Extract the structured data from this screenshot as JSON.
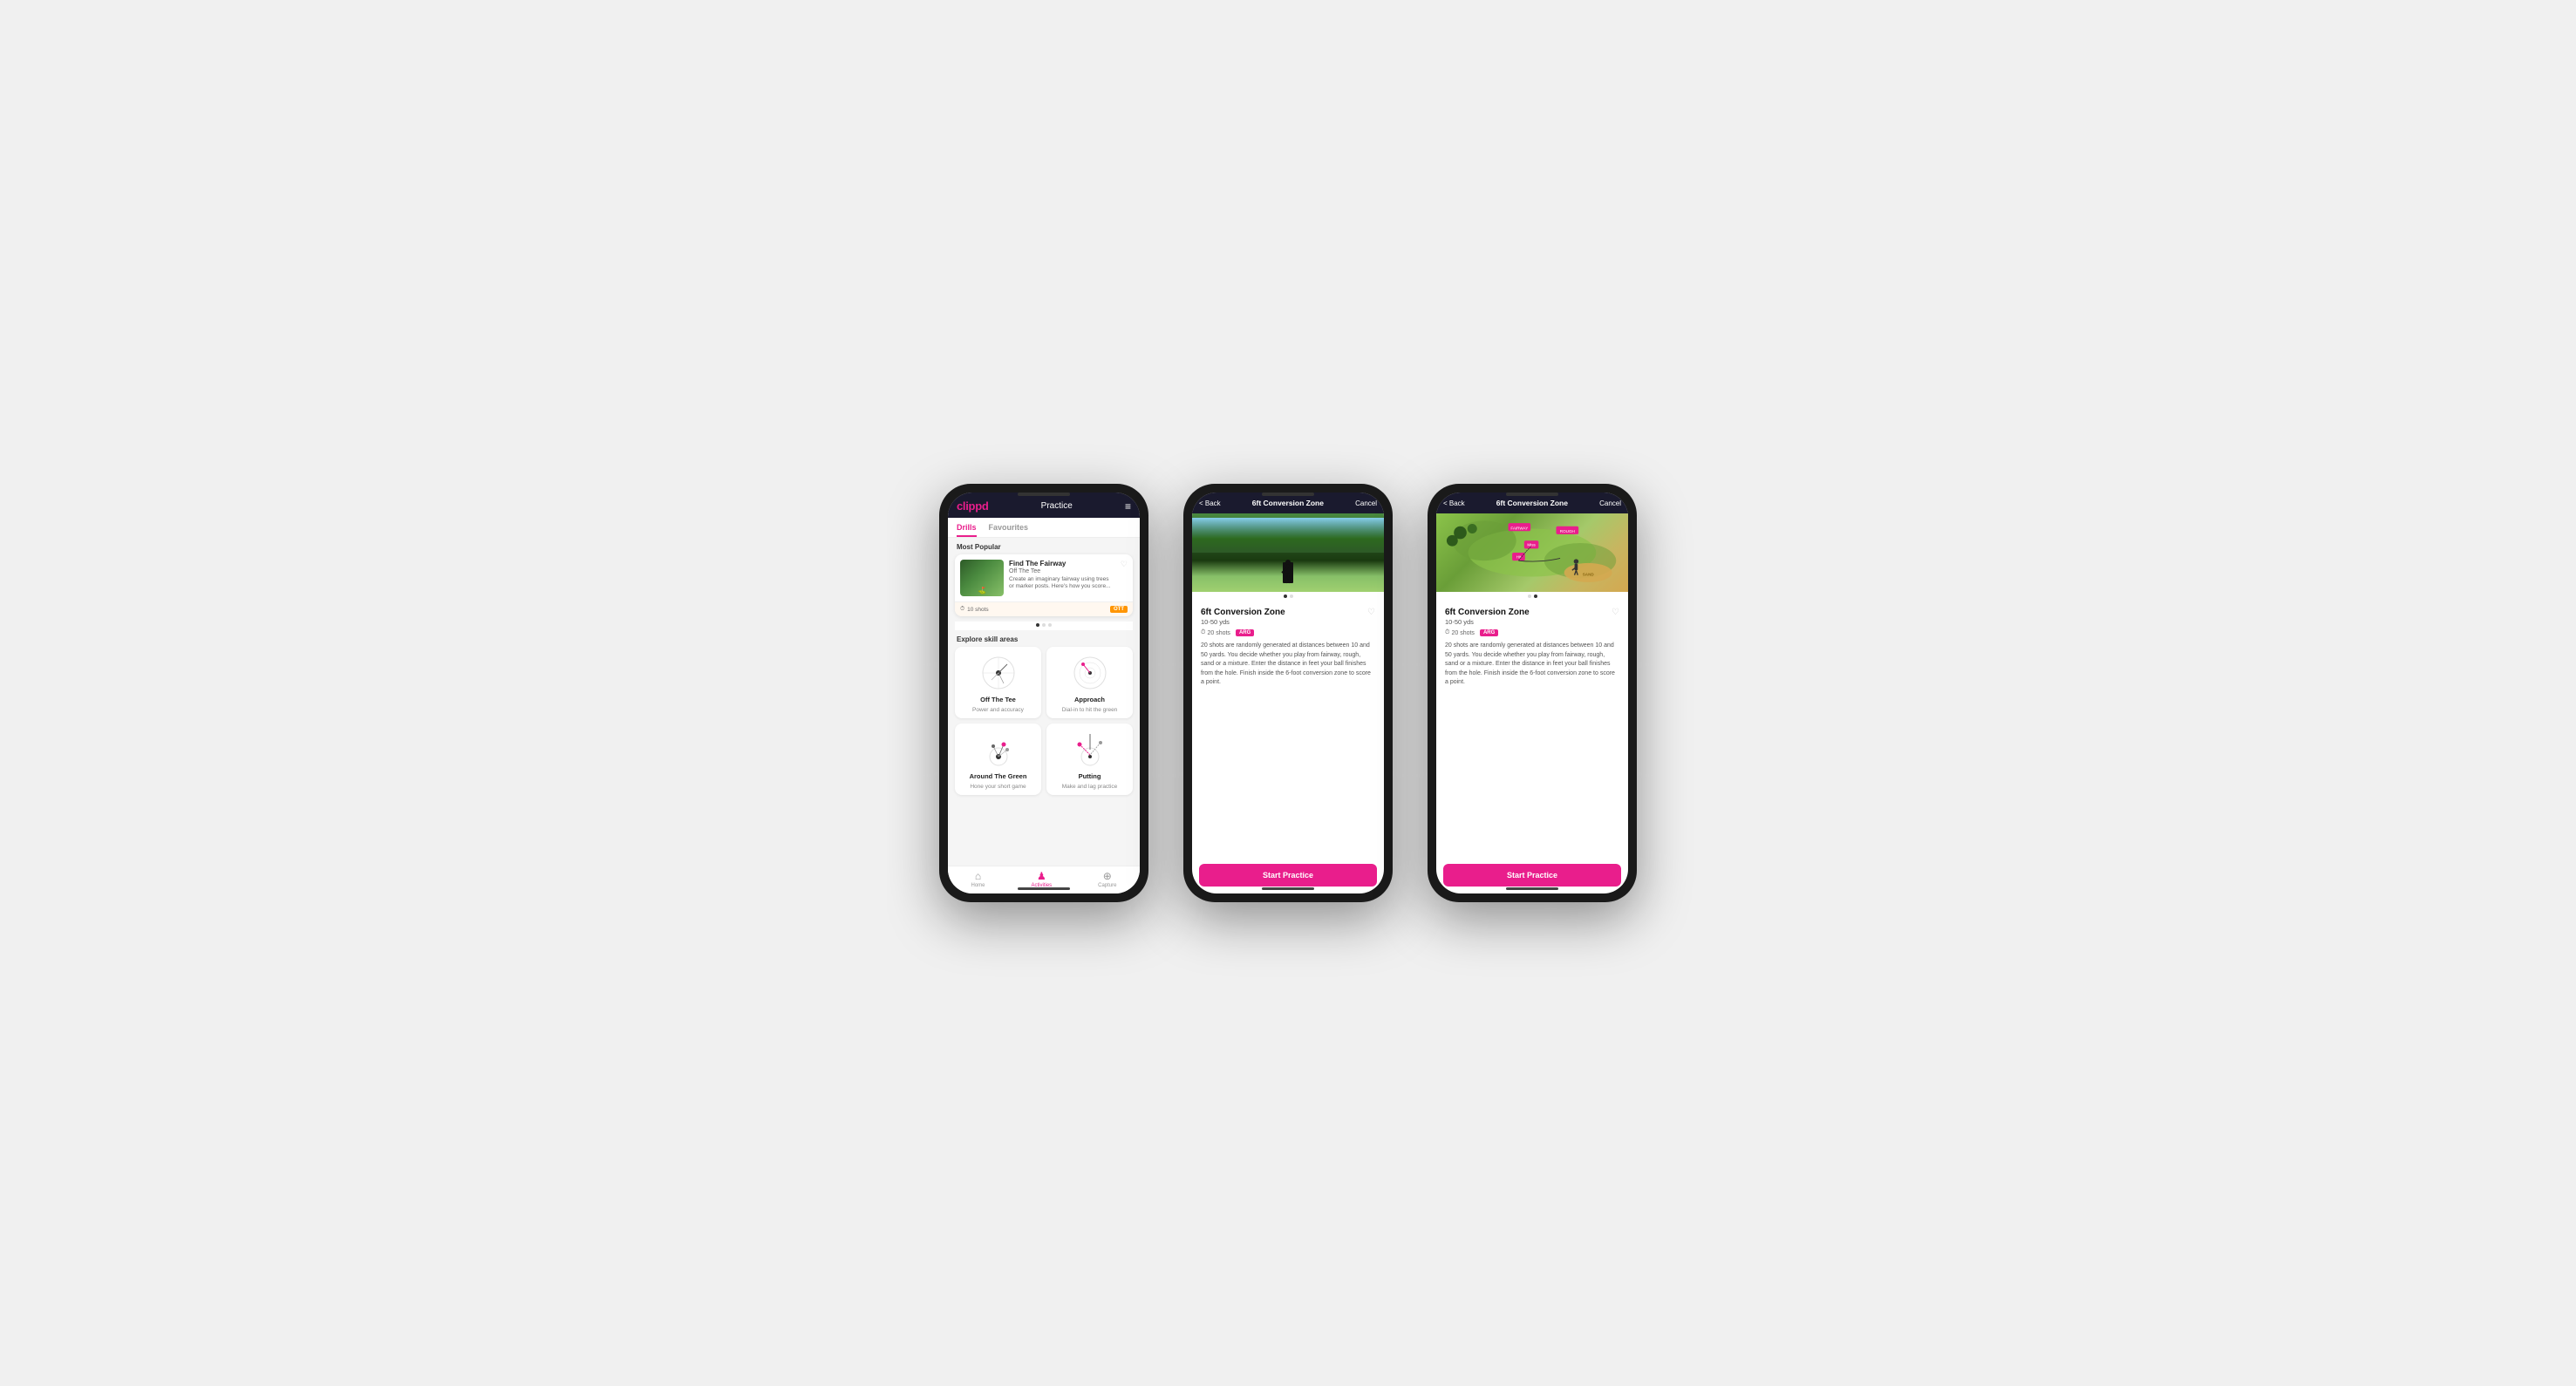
{
  "app": {
    "logo": "clippd",
    "header_title": "Practice",
    "menu_icon": "≡"
  },
  "phone1": {
    "tabs": [
      {
        "label": "Drills",
        "active": true
      },
      {
        "label": "Favourites",
        "active": false
      }
    ],
    "most_popular_label": "Most Popular",
    "featured_drill": {
      "name": "Find The Fairway",
      "category": "Off The Tee",
      "description": "Create an imaginary fairway using trees or marker posts. Here's how you score...",
      "shots": "10 shots",
      "badge": "OTT",
      "fav_icon": "♡"
    },
    "explore_label": "Explore skill areas",
    "skill_areas": [
      {
        "name": "Off The Tee",
        "desc": "Power and accuracy"
      },
      {
        "name": "Approach",
        "desc": "Dial-in to hit the green"
      },
      {
        "name": "Around The Green",
        "desc": "Hone your short game"
      },
      {
        "name": "Putting",
        "desc": "Make and lag practice"
      }
    ],
    "nav": [
      {
        "icon": "⌂",
        "label": "Home",
        "active": false
      },
      {
        "icon": "♟",
        "label": "Activities",
        "active": true
      },
      {
        "icon": "⊕",
        "label": "Capture",
        "active": false
      }
    ]
  },
  "phone2": {
    "back_label": "< Back",
    "title": "6ft Conversion Zone",
    "cancel_label": "Cancel",
    "drill_title": "6ft Conversion Zone",
    "range": "10-50 yds",
    "shots": "20 shots",
    "badge": "ARG",
    "fav_icon": "♡",
    "description": "20 shots are randomly generated at distances between 10 and 50 yards. You decide whether you play from fairway, rough, sand or a mixture. Enter the distance in feet your ball finishes from the hole. Finish inside the 6-foot conversion zone to score a point.",
    "start_btn": "Start Practice",
    "image_type": "photo"
  },
  "phone3": {
    "back_label": "< Back",
    "title": "6ft Conversion Zone",
    "cancel_label": "Cancel",
    "drill_title": "6ft Conversion Zone",
    "range": "10-50 yds",
    "shots": "20 shots",
    "badge": "ARG",
    "fav_icon": "♡",
    "description": "20 shots are randomly generated at distances between 10 and 50 yards. You decide whether you play from fairway, rough, sand or a mixture. Enter the distance in feet your ball finishes from the hole. Finish inside the 6-foot conversion zone to score a point.",
    "start_btn": "Start Practice",
    "image_type": "map"
  },
  "colors": {
    "brand_pink": "#e91e8c",
    "dark_navy": "#1a1a2e",
    "ott_orange": "#ff9500"
  }
}
